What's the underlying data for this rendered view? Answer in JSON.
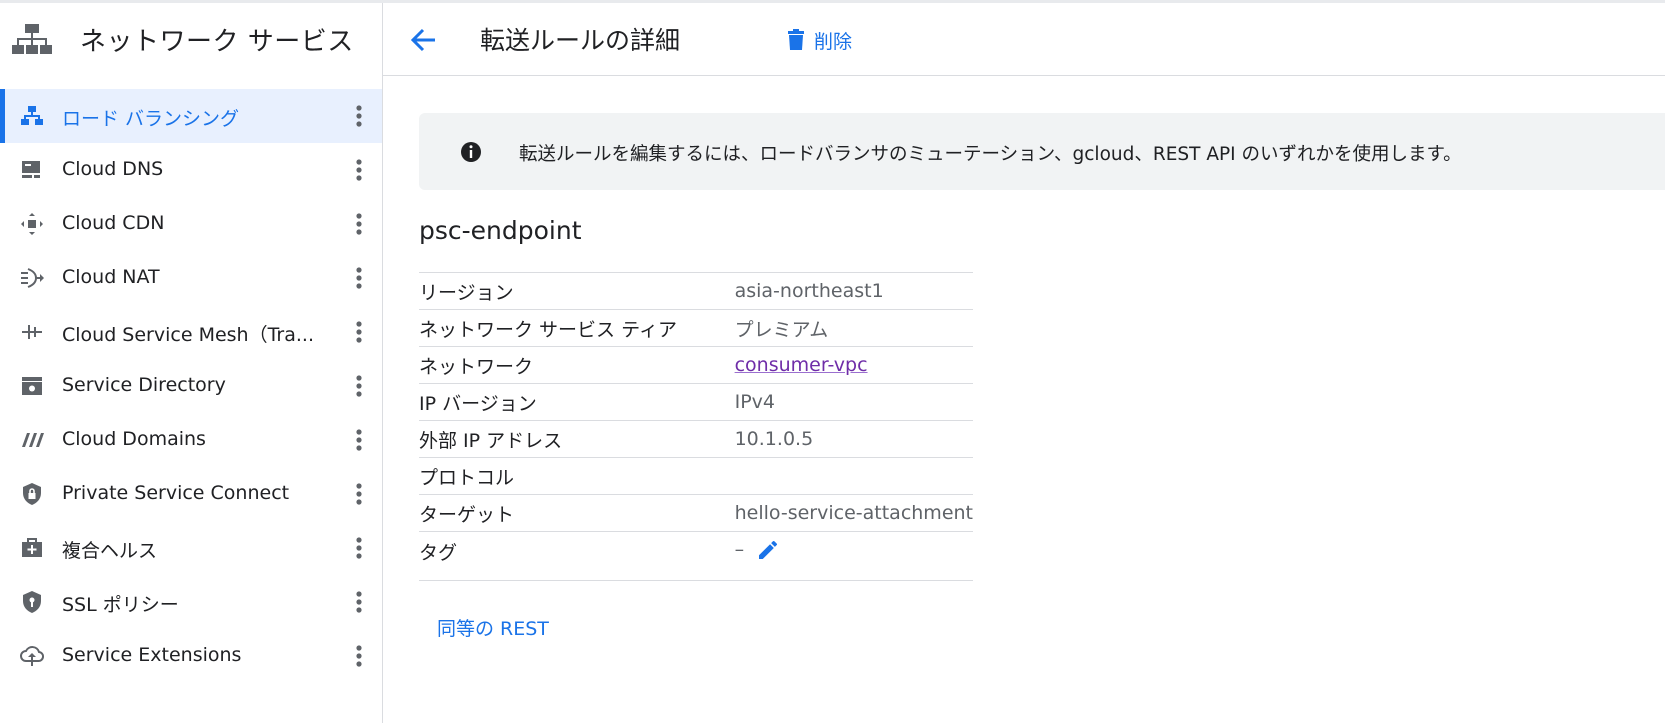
{
  "colors": {
    "accent": "#1a73e8",
    "link_visited": "#6f2da8",
    "text": "#202124",
    "muted": "#5f6368"
  },
  "sidebar": {
    "title": "ネットワーク サービス",
    "icon": "network-services-icon",
    "items": [
      {
        "label": "ロード バランシング",
        "icon": "load-balancing-icon",
        "active": true
      },
      {
        "label": "Cloud DNS",
        "icon": "dns-icon"
      },
      {
        "label": "Cloud CDN",
        "icon": "cdn-icon"
      },
      {
        "label": "Cloud NAT",
        "icon": "nat-icon"
      },
      {
        "label": "Cloud Service Mesh（Tra...",
        "icon": "service-mesh-icon"
      },
      {
        "label": "Service Directory",
        "icon": "service-directory-icon"
      },
      {
        "label": "Cloud Domains",
        "icon": "domains-icon"
      },
      {
        "label": "Private Service Connect",
        "icon": "private-service-connect-icon"
      },
      {
        "label": "複合ヘルス",
        "icon": "composite-health-icon"
      },
      {
        "label": "SSL ポリシー",
        "icon": "ssl-policy-icon"
      },
      {
        "label": "Service Extensions",
        "icon": "service-extensions-icon"
      }
    ]
  },
  "header": {
    "title": "転送ルールの詳細",
    "delete_label": "削除"
  },
  "banner": {
    "text": "転送ルールを編集するには、ロードバランサのミューテーション、gcloud、REST API のいずれかを使用します。"
  },
  "resource": {
    "name": "psc-endpoint",
    "rows": [
      {
        "key": "リージョン",
        "value": "asia-northeast1"
      },
      {
        "key": "ネットワーク サービス ティア",
        "value": "プレミアム"
      },
      {
        "key": "ネットワーク",
        "value": "consumer-vpc"
      },
      {
        "key": "IP バージョン",
        "value": "IPv4"
      },
      {
        "key": "外部 IP アドレス",
        "value": "10.1.0.5"
      },
      {
        "key": "プロトコル",
        "value": ""
      },
      {
        "key": "ターゲット",
        "value": "hello-service-attachment"
      },
      {
        "key": "タグ",
        "value": "–"
      }
    ]
  },
  "rest_link": "同等の REST"
}
